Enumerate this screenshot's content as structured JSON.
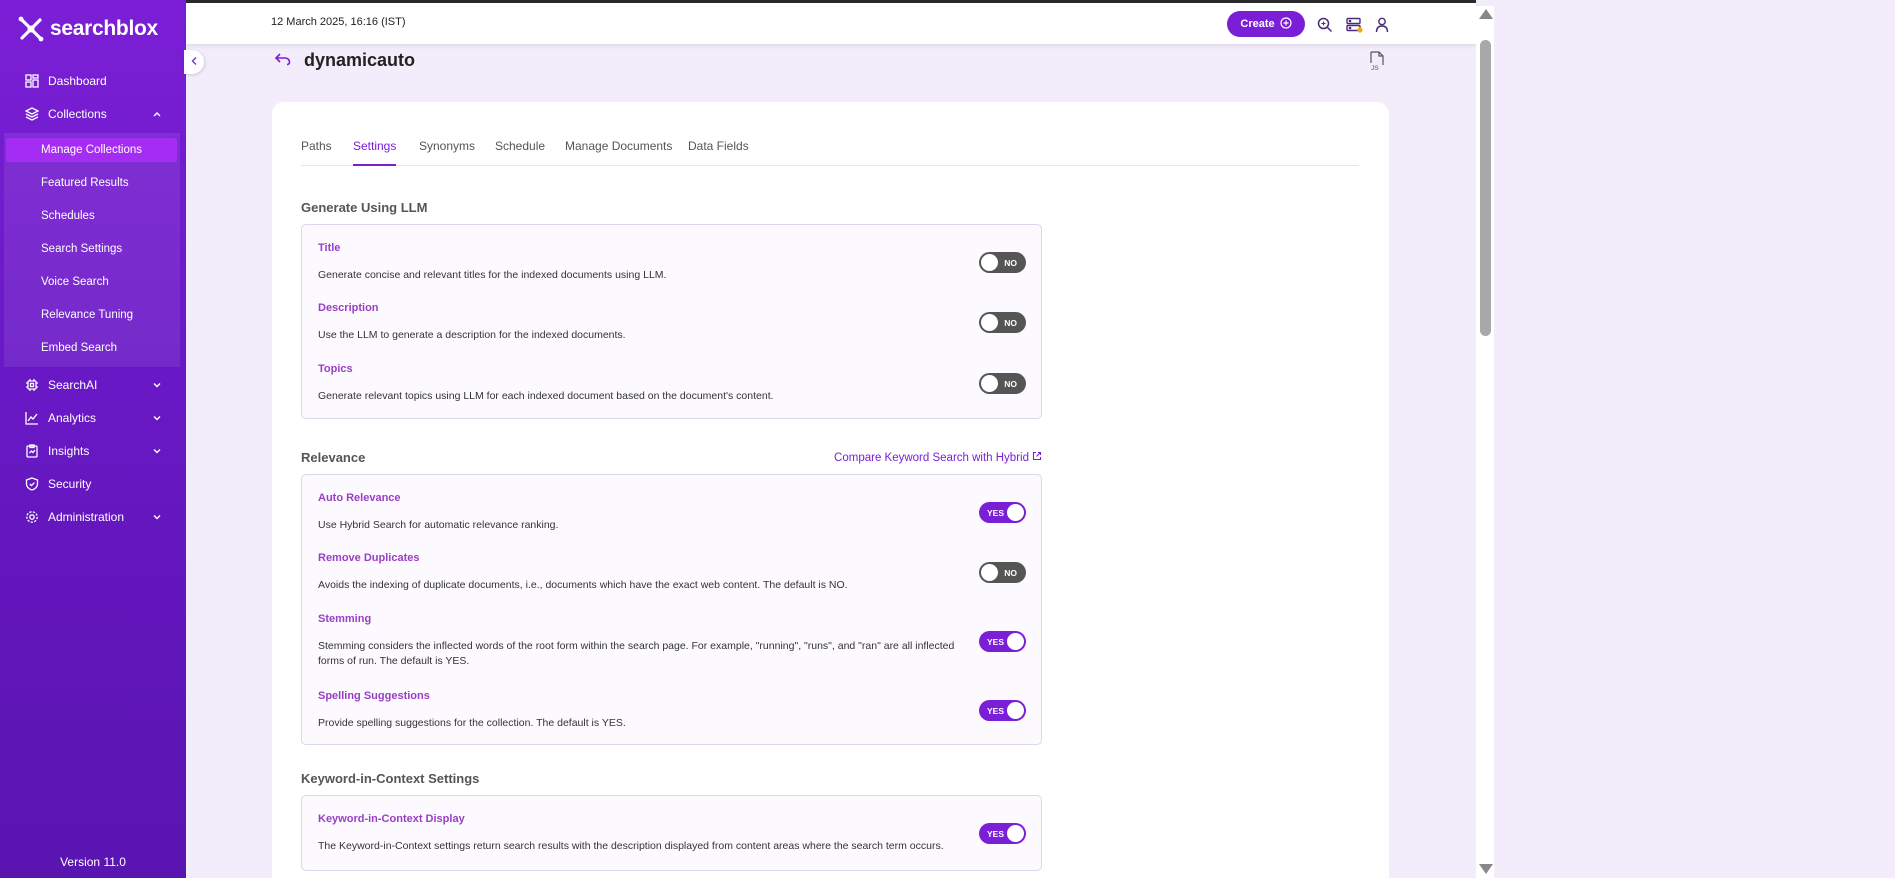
{
  "brand": {
    "name": "searchblox",
    "version": "Version 11.0",
    "accent": "#7b1fd6"
  },
  "topbar": {
    "datetime": "12 March 2025, 16:16 (IST)",
    "create_label": "Create"
  },
  "sidebar": {
    "items": [
      {
        "label": "Dashboard",
        "icon": "dashboard-icon"
      },
      {
        "label": "Collections",
        "icon": "layers-icon"
      },
      {
        "label": "SearchAI",
        "icon": "ai-chip-icon"
      },
      {
        "label": "Analytics",
        "icon": "chart-icon"
      },
      {
        "label": "Insights",
        "icon": "clipboard-icon"
      },
      {
        "label": "Security",
        "icon": "shield-icon"
      },
      {
        "label": "Administration",
        "icon": "gear-icon"
      }
    ],
    "collections_sub": [
      {
        "label": "Manage Collections",
        "active": true
      },
      {
        "label": "Featured Results"
      },
      {
        "label": "Schedules"
      },
      {
        "label": "Search Settings"
      },
      {
        "label": "Voice Search"
      },
      {
        "label": "Relevance Tuning"
      },
      {
        "label": "Embed Search"
      }
    ]
  },
  "page": {
    "title": "dynamicauto"
  },
  "tabs": [
    "Paths",
    "Settings",
    "Synonyms",
    "Schedule",
    "Manage Documents",
    "Data Fields"
  ],
  "active_tab": "Settings",
  "sections": {
    "llm": {
      "title": "Generate Using LLM",
      "settings": [
        {
          "label": "Title",
          "desc": "Generate concise and relevant titles for the indexed documents using LLM.",
          "value": "NO"
        },
        {
          "label": "Description",
          "desc": "Use the LLM to generate a description for the indexed documents.",
          "value": "NO"
        },
        {
          "label": "Topics",
          "desc": "Generate relevant topics using LLM for each indexed document based on the document's content.",
          "value": "NO"
        }
      ]
    },
    "relevance": {
      "title": "Relevance",
      "link": "Compare Keyword Search with Hybrid",
      "settings": [
        {
          "label": "Auto Relevance",
          "desc": "Use Hybrid Search for automatic relevance ranking.",
          "value": "YES"
        },
        {
          "label": "Remove Duplicates",
          "desc": "Avoids the indexing of duplicate documents, i.e., documents which have the exact web content. The default is NO.",
          "value": "NO"
        },
        {
          "label": "Stemming",
          "desc": "Stemming considers the inflected words of the root form within the search page. For example, \"running\", \"runs\", and \"ran\" are all inflected forms of run. The default is YES.",
          "value": "YES"
        },
        {
          "label": "Spelling Suggestions",
          "desc": "Provide spelling suggestions for the collection. The default is YES.",
          "value": "YES"
        }
      ]
    },
    "kic": {
      "title": "Keyword-in-Context Settings",
      "settings": [
        {
          "label": "Keyword-in-Context Display",
          "desc": "The Keyword-in-Context settings return search results with the description displayed from content areas where the search term occurs.",
          "value": "YES"
        }
      ]
    }
  }
}
